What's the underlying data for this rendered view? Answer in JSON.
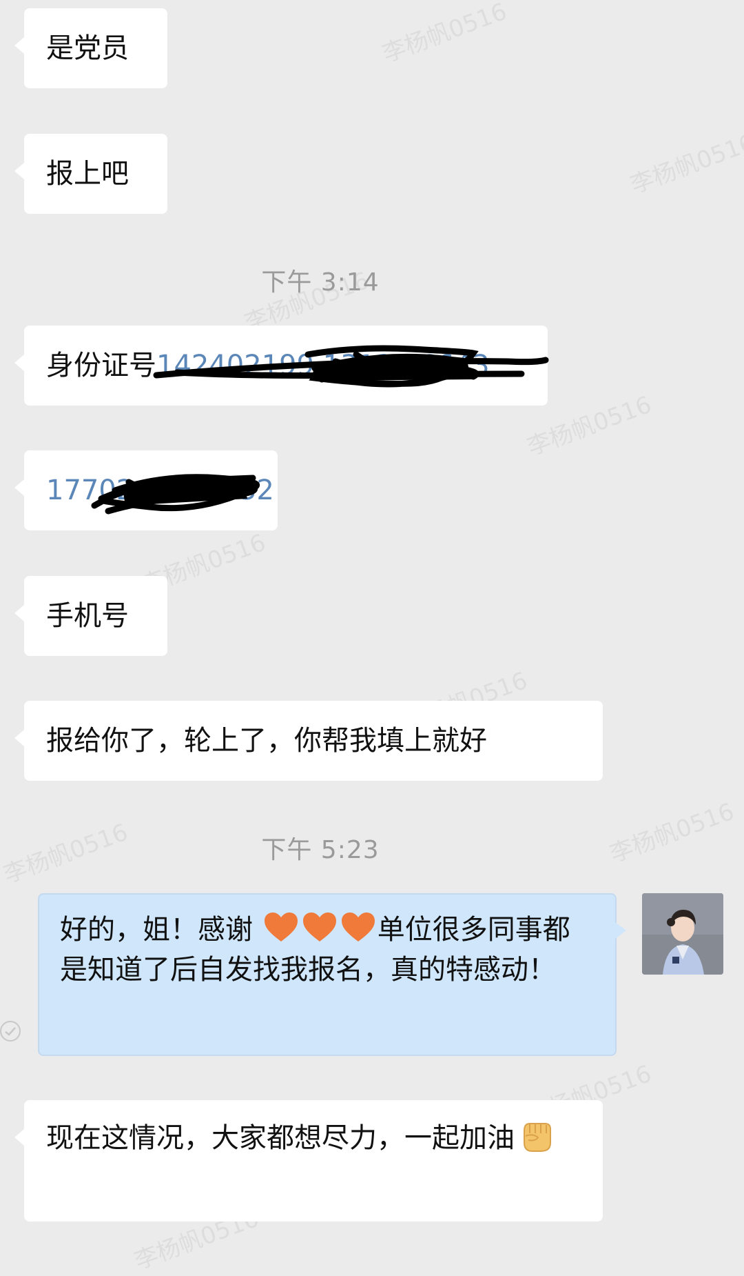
{
  "messages": {
    "m1": "是党员",
    "m2": "报上吧",
    "ts1": "下午 3:14",
    "m3_label": "身份证号",
    "m3_number": "142402199 1313 06643",
    "m4_number": "17702 56626 32",
    "m5": "手机号",
    "m6": "报给你了，轮上了，你帮我填上就好",
    "ts2": "下午 5:23",
    "m7_part1": "好的，姐！感谢",
    "m7_part2": "单位很多同事都是知道了后自发找我报名，真的特感动！",
    "m8": "现在这情况，大家都想尽力，一起加油"
  },
  "watermark": "李杨帆0516",
  "icons": {
    "heart": "orange-heart-icon",
    "fist": "raised-fist-icon",
    "read": "read-check-icon"
  },
  "colors": {
    "background": "#ebebeb",
    "incoming_bubble": "#ffffff",
    "outgoing_bubble": "#d0e6fb",
    "link": "#5b86b8",
    "timestamp": "#9a9a9a",
    "heart": "#f07a3a"
  }
}
